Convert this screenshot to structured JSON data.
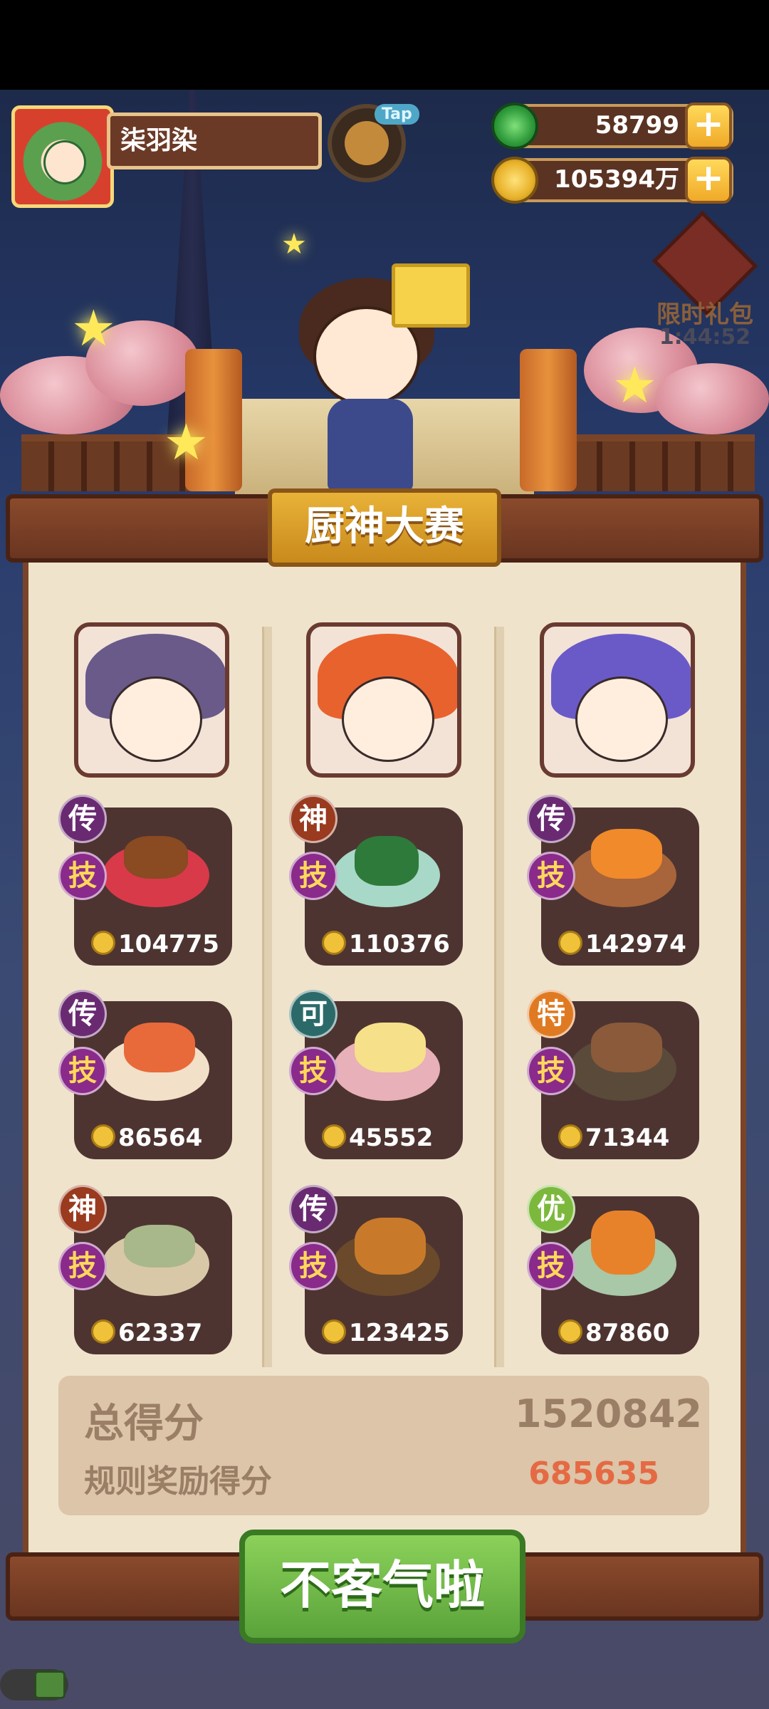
{
  "player": {
    "name": "柒羽染"
  },
  "tap_button": {
    "label": "Tap"
  },
  "currency": {
    "jade": {
      "value": "58799",
      "icon": "jade-coin-icon"
    },
    "gold": {
      "value": "105394万",
      "icon": "gold-coin-icon"
    }
  },
  "gift": {
    "label": "限时礼包",
    "timer": "1:44:52"
  },
  "contest": {
    "title": "厨神大赛"
  },
  "chefs": [
    {
      "portrait": "purple-hair-chef-portrait"
    },
    {
      "portrait": "orange-hair-chef-portrait"
    },
    {
      "portrait": "blue-hair-chef-portrait"
    }
  ],
  "dishes": [
    [
      {
        "grade": "传",
        "tag": "技",
        "score": "104775"
      },
      {
        "grade": "传",
        "tag": "技",
        "score": "86564"
      },
      {
        "grade": "神",
        "tag": "技",
        "score": "62337"
      }
    ],
    [
      {
        "grade": "神",
        "tag": "技",
        "score": "110376"
      },
      {
        "grade": "可",
        "tag": "技",
        "score": "45552"
      },
      {
        "grade": "传",
        "tag": "技",
        "score": "123425"
      }
    ],
    [
      {
        "grade": "传",
        "tag": "技",
        "score": "142974"
      },
      {
        "grade": "特",
        "tag": "技",
        "score": "71344"
      },
      {
        "grade": "优",
        "tag": "技",
        "score": "87860"
      }
    ]
  ],
  "totals": {
    "total_label": "总得分",
    "total_value": "1520842",
    "bonus_label": "规则奖励得分",
    "bonus_value": "685635"
  },
  "confirm_button": {
    "label": "不客气啦"
  },
  "colors": {
    "accent_green": "#5aa33a",
    "wood": "#6a3520",
    "bonus_red": "#e56a44"
  }
}
